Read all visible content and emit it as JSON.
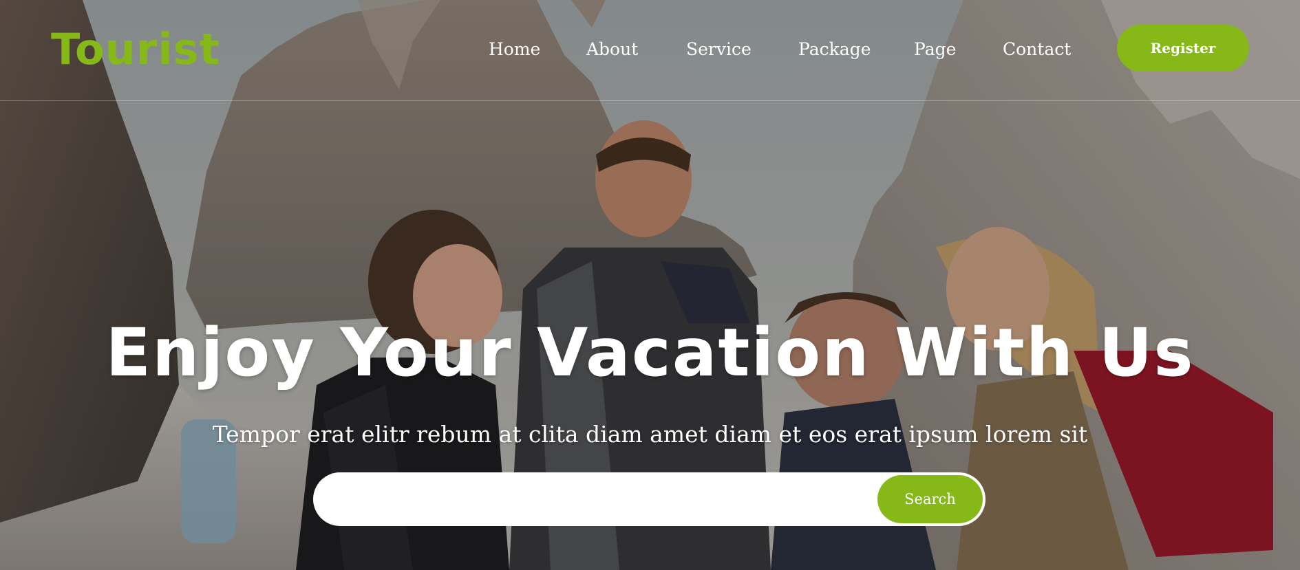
{
  "brand": {
    "logo_text": "Tourist",
    "accent_color": "#86b817"
  },
  "nav": {
    "items": [
      {
        "label": "Home"
      },
      {
        "label": "About"
      },
      {
        "label": "Service"
      },
      {
        "label": "Package"
      },
      {
        "label": "Page"
      },
      {
        "label": "Contact"
      }
    ],
    "register_label": "Register"
  },
  "hero": {
    "title": "Enjoy Your Vacation With Us",
    "subtitle": "Tempor erat elitr rebum at clita diam amet diam et eos erat ipsum lorem sit",
    "background": "photo of friends hiking in front of rocky mountains"
  },
  "search": {
    "placeholder": "",
    "button_label": "Search"
  }
}
